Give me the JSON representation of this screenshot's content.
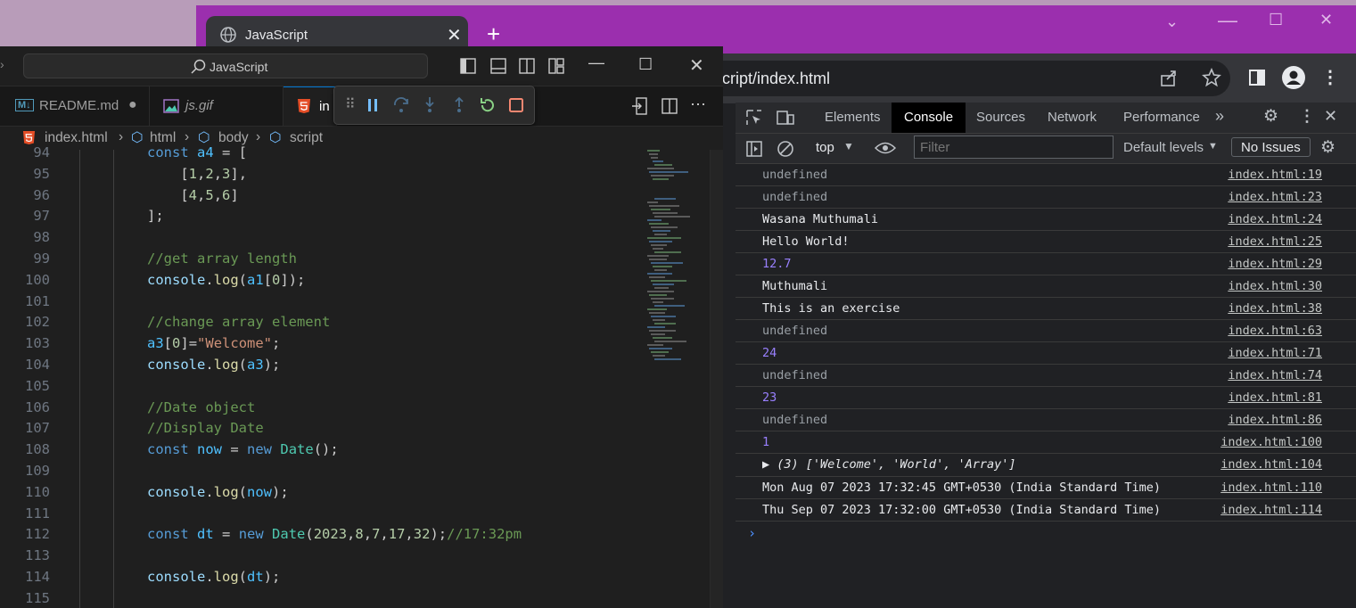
{
  "browser": {
    "tab_title": "JavaScript",
    "url_fragment": "cript/index.html"
  },
  "devtools": {
    "tabs": [
      "Elements",
      "Console",
      "Sources",
      "Network",
      "Performance"
    ],
    "active_tab": "Console",
    "context": "top",
    "filter_placeholder": "Filter",
    "levels": "Default levels",
    "issues": "No Issues",
    "console_rows": [
      {
        "msg": "undefined",
        "kind": "undef",
        "src": "index.html:19"
      },
      {
        "msg": "undefined",
        "kind": "undef",
        "src": "index.html:23"
      },
      {
        "msg": "Wasana Muthumali",
        "kind": "text",
        "src": "index.html:24"
      },
      {
        "msg": "Hello World!",
        "kind": "text",
        "src": "index.html:25"
      },
      {
        "msg": "12.7",
        "kind": "num",
        "src": "index.html:29"
      },
      {
        "msg": "Muthumali",
        "kind": "text",
        "src": "index.html:30"
      },
      {
        "msg": "This is an exercise",
        "kind": "text",
        "src": "index.html:38"
      },
      {
        "msg": "undefined",
        "kind": "undef",
        "src": "index.html:63"
      },
      {
        "msg": "24",
        "kind": "num",
        "src": "index.html:71"
      },
      {
        "msg": "undefined",
        "kind": "undef",
        "src": "index.html:74"
      },
      {
        "msg": "23",
        "kind": "num",
        "src": "index.html:81"
      },
      {
        "msg": "undefined",
        "kind": "undef",
        "src": "index.html:86"
      },
      {
        "msg": "1",
        "kind": "num",
        "src": "index.html:100"
      },
      {
        "msg": "▶ (3) ['Welcome', 'World', 'Array']",
        "kind": "array",
        "src": "index.html:104"
      },
      {
        "msg": "Mon Aug 07 2023 17:32:45 GMT+0530 (India Standard Time)",
        "kind": "text",
        "src": "index.html:110"
      },
      {
        "msg": "Thu Sep 07 2023 17:32:00 GMT+0530 (India Standard Time)",
        "kind": "text",
        "src": "index.html:114"
      }
    ]
  },
  "vscode": {
    "command_center": "JavaScript",
    "tabs": [
      {
        "label": "README.md",
        "icon": "markdown-icon"
      },
      {
        "label": "js.gif",
        "icon": "image-icon"
      },
      {
        "label": "in",
        "icon": "html5-icon"
      }
    ],
    "breadcrumb": [
      "index.html",
      "html",
      "body",
      "script"
    ],
    "lines": [
      {
        "n": "94",
        "code": "const a4 = ["
      },
      {
        "n": "95",
        "code": "    [1,2,3],"
      },
      {
        "n": "96",
        "code": "    [4,5,6]"
      },
      {
        "n": "97",
        "code": "];"
      },
      {
        "n": "98",
        "code": ""
      },
      {
        "n": "99",
        "code": "//get array length"
      },
      {
        "n": "100",
        "code": "console.log(a1[0]);"
      },
      {
        "n": "101",
        "code": ""
      },
      {
        "n": "102",
        "code": "//change array element"
      },
      {
        "n": "103",
        "code": "a3[0]=\"Welcome\";"
      },
      {
        "n": "104",
        "code": "console.log(a3);"
      },
      {
        "n": "105",
        "code": ""
      },
      {
        "n": "106",
        "code": "//Date object"
      },
      {
        "n": "107",
        "code": "//Display Date"
      },
      {
        "n": "108",
        "code": "const now = new Date();"
      },
      {
        "n": "109",
        "code": ""
      },
      {
        "n": "110",
        "code": "console.log(now);"
      },
      {
        "n": "111",
        "code": ""
      },
      {
        "n": "112",
        "code": "const dt = new Date(2023,8,7,17,32);//17:32pm"
      },
      {
        "n": "113",
        "code": ""
      },
      {
        "n": "114",
        "code": "console.log(dt);"
      },
      {
        "n": "115",
        "code": ""
      }
    ]
  },
  "colors": {
    "chrome_titlebar": "#9b2fae",
    "vscode_bg": "#1f1f1f",
    "devtools_bg": "#202124",
    "accent_blue": "#0078d4"
  }
}
